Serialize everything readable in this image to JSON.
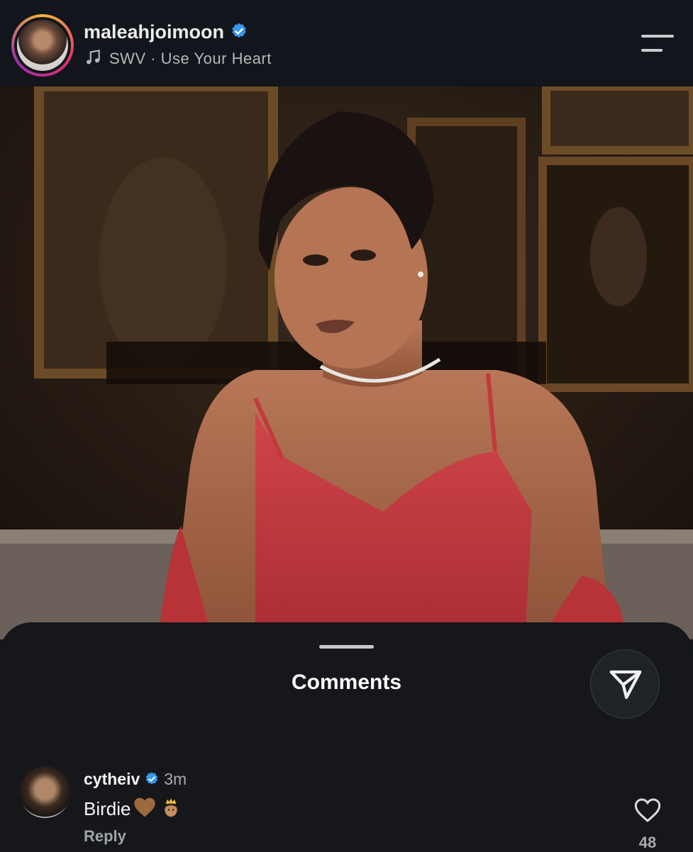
{
  "post_header": {
    "username": "maleahjoimoon",
    "music_text": "SWV · Use Your Heart"
  },
  "comments_sheet": {
    "title": "Comments"
  },
  "comment": {
    "username": "cytheiv",
    "time": "3m",
    "text": "Birdie",
    "reply_label": "Reply",
    "like_count": "48"
  },
  "colors": {
    "verified_blue": "#3897f0",
    "background": "#15171b",
    "dress_red": "#c23a3d"
  },
  "icons": {
    "verified": "verified-badge-icon",
    "music": "music-note-icon",
    "menu": "menu-icon",
    "share": "send-icon",
    "like": "heart-outline-icon"
  }
}
